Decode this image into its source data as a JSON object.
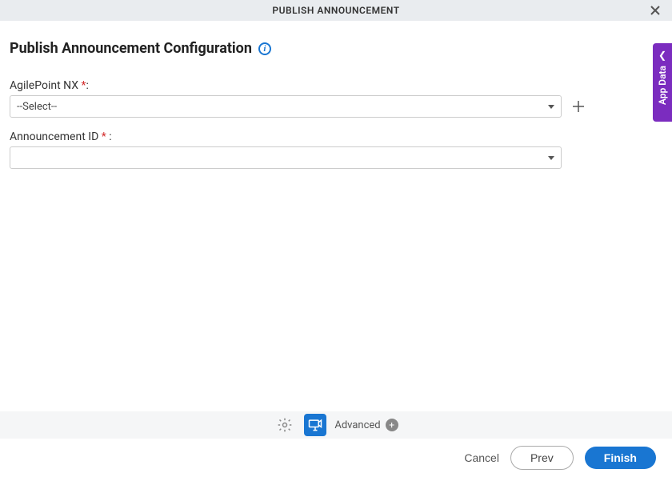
{
  "header": {
    "title": "PUBLISH ANNOUNCEMENT"
  },
  "page": {
    "title": "Publish Announcement Configuration"
  },
  "fields": {
    "agilepoint": {
      "label": "AgilePoint NX",
      "required_mark": "*",
      "suffix": ":",
      "value": "--Select--"
    },
    "announcement_id": {
      "label": "Announcement ID",
      "required_mark": "*",
      "suffix": " :",
      "value": ""
    }
  },
  "toolbar": {
    "advanced_label": "Advanced"
  },
  "footer": {
    "cancel": "Cancel",
    "prev": "Prev",
    "finish": "Finish"
  },
  "side_tab": {
    "label": "App Data"
  }
}
